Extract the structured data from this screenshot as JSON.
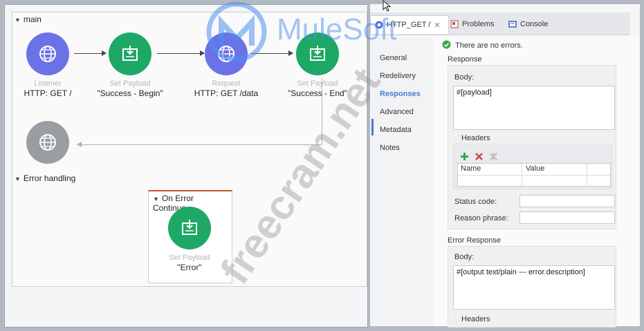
{
  "canvas": {
    "main_label": "main",
    "error_label": "Error handling",
    "on_error_label": "On Error Continue",
    "nodes": [
      {
        "caption": "Listener",
        "value": "HTTP: GET /",
        "icon": "globe-icon"
      },
      {
        "caption": "Set Payload",
        "value": "\"Success - Begin\"",
        "icon": "set-payload-icon"
      },
      {
        "caption": "Request",
        "value": "HTTP: GET /data",
        "icon": "globe-icon"
      },
      {
        "caption": "Set Payload",
        "value": "\"Success - End\"",
        "icon": "set-payload-icon"
      },
      {
        "caption": "",
        "value": "",
        "icon": "globe-icon"
      }
    ],
    "error_node": {
      "caption": "Set Payload",
      "value": "\"Error\"",
      "icon": "set-payload-icon"
    }
  },
  "panel": {
    "tabs": [
      {
        "label": "HTTP_GET /",
        "icon": "mule-icon",
        "close": "✕"
      },
      {
        "label": "Problems",
        "icon": "problems-icon"
      },
      {
        "label": "Console",
        "icon": "console-icon"
      }
    ],
    "status": "There are no errors.",
    "nav": [
      "General",
      "Redelivery",
      "Responses",
      "Advanced",
      "Metadata",
      "Notes"
    ],
    "response": {
      "title": "Response",
      "body_label": "Body:",
      "body_value": "#[payload]",
      "headers_label": "Headers",
      "columns": [
        "Name",
        "Value"
      ],
      "status_code_label": "Status code:",
      "reason_phrase_label": "Reason phrase:"
    },
    "error_response": {
      "title": "Error Response",
      "body_label": "Body:",
      "body_value": "#[output text/plain --- error.description]",
      "headers_label": "Headers"
    }
  },
  "watermarks": {
    "brand": "MuleSoft",
    "site": "freecram.net"
  },
  "colors": {
    "listener": "#6b72e6",
    "payload": "#1ea866",
    "inactive": "#9a9da3",
    "accent": "#4a7bd0"
  }
}
